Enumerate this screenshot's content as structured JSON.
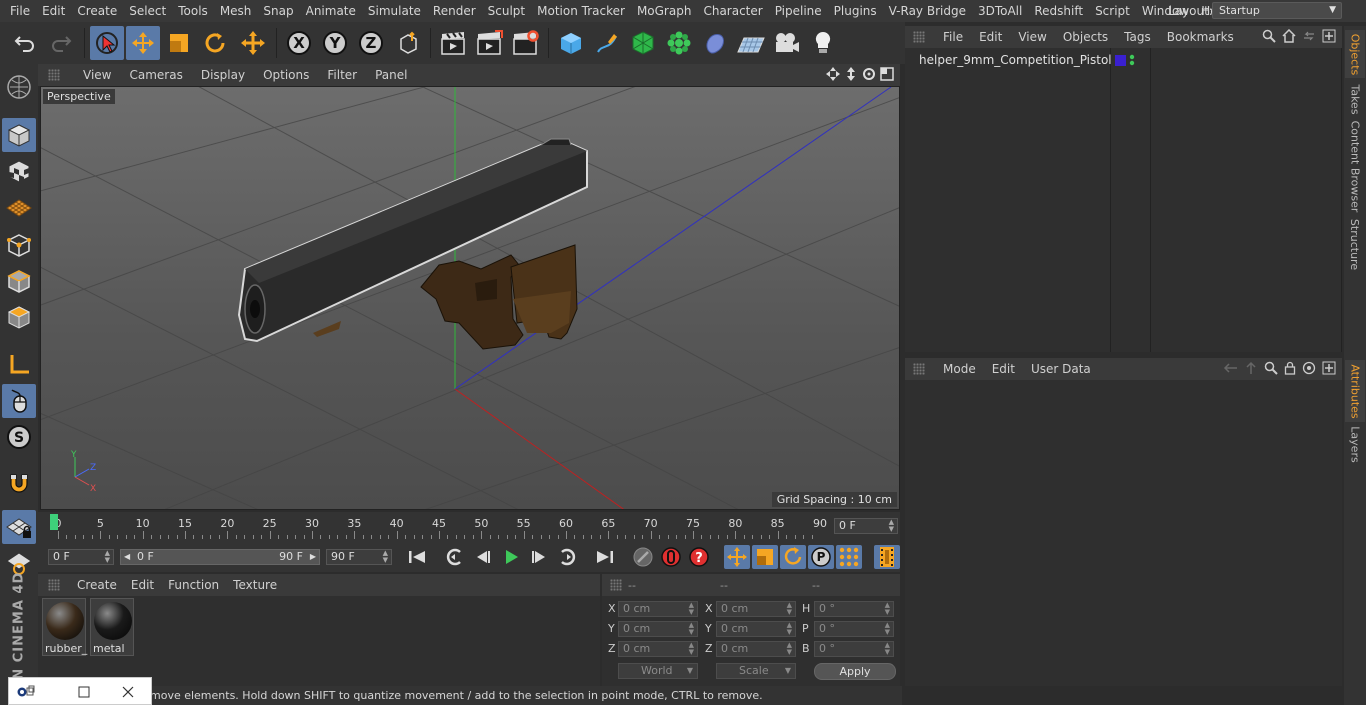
{
  "menu": {
    "items": [
      "File",
      "Edit",
      "Create",
      "Select",
      "Tools",
      "Mesh",
      "Snap",
      "Animate",
      "Simulate",
      "Render",
      "Sculpt",
      "Motion Tracker",
      "MoGraph",
      "Character",
      "Pipeline",
      "Plugins",
      "V-Ray Bridge",
      "3DToAll",
      "Redshift",
      "Script",
      "Window",
      "Help"
    ],
    "layout_label": "Layout:",
    "layout_value": "Startup"
  },
  "toolbar": {
    "axis_x": "X",
    "axis_y": "Y",
    "axis_z": "Z"
  },
  "left_toolbar": {
    "brand": "MAXON CINEMA 4D"
  },
  "viewport": {
    "menu": [
      "View",
      "Cameras",
      "Display",
      "Options",
      "Filter",
      "Panel"
    ],
    "label": "Perspective",
    "grid_spacing": "Grid Spacing : 10 cm",
    "axis_labels": [
      "Y",
      "Z",
      "X"
    ]
  },
  "timeline": {
    "ticks": [
      "0",
      "5",
      "10",
      "15",
      "20",
      "25",
      "30",
      "35",
      "40",
      "45",
      "50",
      "55",
      "60",
      "65",
      "70",
      "75",
      "80",
      "85",
      "90"
    ],
    "current_frame": "0 F"
  },
  "transport": {
    "start_frame": "0 F",
    "range_start": "0 F",
    "range_end": "90 F",
    "end_frame": "90 F",
    "record_letter": "P"
  },
  "materials": {
    "menu": [
      "Create",
      "Edit",
      "Function",
      "Texture"
    ],
    "items": [
      {
        "name": "rubber_",
        "color": "#3a2a1a"
      },
      {
        "name": "metal",
        "color": "#1a1a1a"
      }
    ]
  },
  "coordinates": {
    "headers": [
      "--",
      "--",
      "--"
    ],
    "rows": [
      {
        "l1": "X",
        "v1": "0 cm",
        "l2": "X",
        "v2": "0 cm",
        "l3": "H",
        "v3": "0 °"
      },
      {
        "l1": "Y",
        "v1": "0 cm",
        "l2": "Y",
        "v2": "0 cm",
        "l3": "P",
        "v3": "0 °"
      },
      {
        "l1": "Z",
        "v1": "0 cm",
        "l2": "Z",
        "v2": "0 cm",
        "l3": "B",
        "v3": "0 °"
      }
    ],
    "space": "World",
    "mode": "Scale",
    "apply_label": "Apply"
  },
  "status": {
    "text": "move elements. Hold down SHIFT to quantize movement / add to the selection in point mode, CTRL to remove."
  },
  "objects": {
    "menu": [
      "File",
      "Edit",
      "View",
      "Objects",
      "Tags",
      "Bookmarks"
    ],
    "tree": [
      {
        "name": "helper_9mm_Competition_Pistol",
        "layer_color": "#3a20d0"
      }
    ]
  },
  "attributes": {
    "menu": [
      "Mode",
      "Edit",
      "User Data"
    ]
  },
  "right_tabs": [
    "Objects",
    "Takes",
    "Content Browser",
    "Structure",
    "Attributes",
    "Layers"
  ],
  "colors": {
    "accent": "#5a7aa8",
    "playhead": "#3ed07a",
    "active_tab": "#f0a030"
  }
}
